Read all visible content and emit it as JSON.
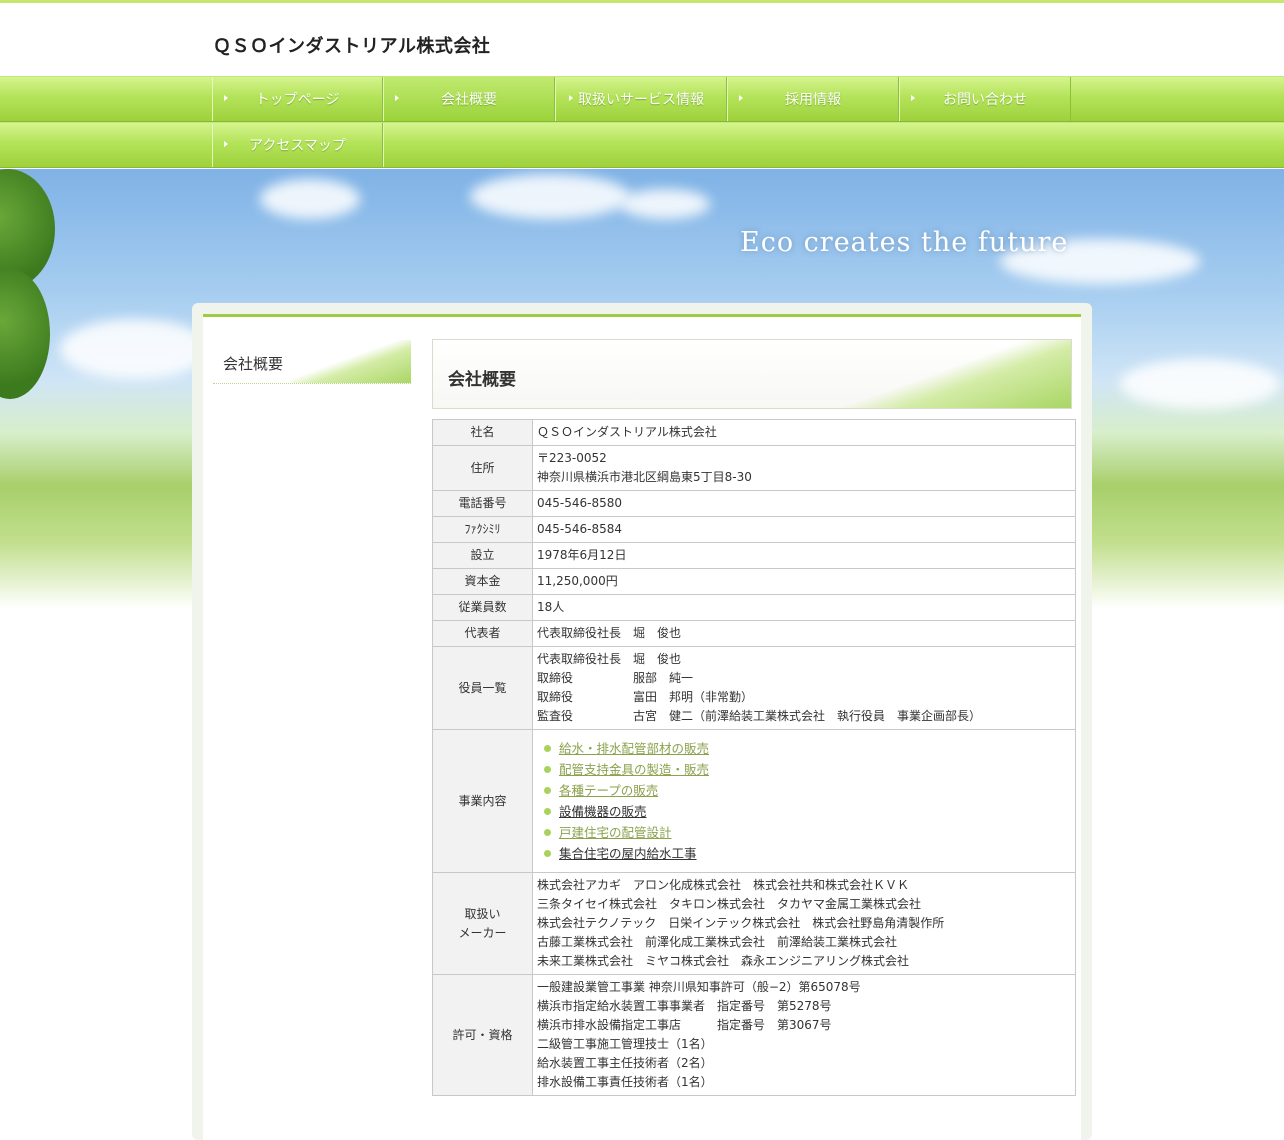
{
  "site": {
    "title": "ＱＳＯインダストリアル株式会社"
  },
  "nav": {
    "items": [
      {
        "label": "トップページ"
      },
      {
        "label": "会社概要"
      },
      {
        "label": "取扱いサービス情報"
      },
      {
        "label": "採用情報"
      },
      {
        "label": "お問い合わせ"
      },
      {
        "label": "アクセスマップ"
      }
    ],
    "active": "会社概要"
  },
  "hero": {
    "tagline": "Eco creates the future"
  },
  "sidebar": {
    "heading": "会社概要"
  },
  "main": {
    "heading": "会社概要"
  },
  "company": {
    "rows": [
      {
        "label": "社名",
        "value": "ＱＳＯインダストリアル株式会社"
      },
      {
        "label": "住所",
        "value": "〒223-0052\n神奈川県横浜市港北区綱島東5丁目8-30"
      },
      {
        "label": "電話番号",
        "value": "045-546-8580"
      },
      {
        "label": "ﾌｧｸｼﾐﾘ",
        "value": "045-546-8584"
      },
      {
        "label": "設立",
        "value": "1978年6月12日"
      },
      {
        "label": "資本金",
        "value": "11,250,000円"
      },
      {
        "label": "従業員数",
        "value": "18人"
      },
      {
        "label": "代表者",
        "value": "代表取締役社長　堀　俊也"
      },
      {
        "label": "役員一覧",
        "value": "代表取締役社長　堀　俊也\n取締役　　　　　服部　純一\n取締役　　　　　富田　邦明（非常勤）\n監査役　　　　　古宮　健二（前澤給装工業株式会社　執行役員　事業企画部長）"
      },
      {
        "label": "事業内容",
        "value": ""
      },
      {
        "label": "取扱い\nメーカー",
        "value": "株式会社アカギ　アロン化成株式会社　株式会社共和株式会社ＫＶＫ\n三条タイセイ株式会社　タキロン株式会社　タカヤマ金属工業株式会社\n株式会社テクノテック　日栄インテック株式会社　株式会社野島角清製作所\n古藤工業株式会社　前澤化成工業株式会社　前澤給装工業株式会社\n未来工業株式会社　ミヤコ株式会社　森永エンジニアリング株式会社"
      },
      {
        "label": "許可・資格",
        "value": "一般建設業管工事業 神奈川県知事許可（般−2）第65078号\n横浜市指定給水装置工事事業者　指定番号　第5278号\n横浜市排水設備指定工事店　　　指定番号　第3067号\n二級管工事施工管理技士（1名）\n給水装置工事主任技術者（2名）\n排水設備工事責任技術者（1名）"
      }
    ],
    "business": [
      {
        "label": "給水・排水配管部材の販売",
        "style": "link"
      },
      {
        "label": "配管支持金具の製造・販売",
        "style": "link"
      },
      {
        "label": "各種テープの販売",
        "style": "link"
      },
      {
        "label": "設備機器の販売",
        "style": "dark"
      },
      {
        "label": "戸建住宅の配管設計",
        "style": "link"
      },
      {
        "label": "集合住宅の屋内給水工事",
        "style": "dark"
      }
    ]
  }
}
